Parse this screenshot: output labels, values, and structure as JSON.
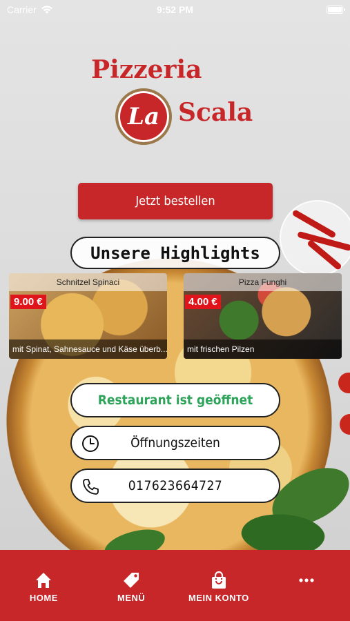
{
  "status_bar": {
    "carrier": "Carrier",
    "time": "9:52 PM"
  },
  "logo": {
    "line1": "Pizzeria",
    "badge_text": "La",
    "line2": "Scala"
  },
  "order_button": {
    "label": "Jetzt bestellen"
  },
  "highlights": {
    "title": "Unsere Highlights",
    "items": [
      {
        "name": "Schnitzel Spinaci",
        "price": "9.00 €",
        "description": "mit Spinat, Sahnesauce und Käse überb..."
      },
      {
        "name": "Pizza Funghi",
        "price": "4.00 €",
        "description": "mit frischen Pilzen"
      }
    ]
  },
  "status": {
    "open_label": "Restaurant ist geöffnet"
  },
  "hours": {
    "label": "Öffnungszeiten",
    "icon": "clock-icon"
  },
  "phone": {
    "number": "017623664727",
    "icon": "phone-icon"
  },
  "tabbar": {
    "items": [
      {
        "label": "HOME",
        "icon": "home-icon"
      },
      {
        "label": "MENÜ",
        "icon": "tag-icon"
      },
      {
        "label": "MEIN KONTO",
        "icon": "bag-icon"
      },
      {
        "label": "",
        "icon": "more-icon"
      }
    ]
  },
  "colors": {
    "brand_red": "#c8272a",
    "price_red": "#e0151b",
    "open_green": "#2ea35a"
  }
}
